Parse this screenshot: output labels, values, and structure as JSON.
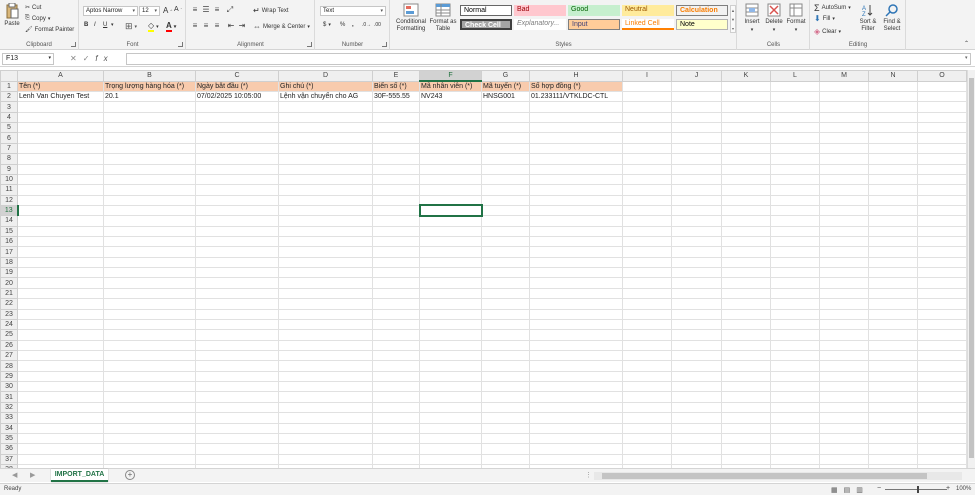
{
  "ribbon": {
    "clipboard": {
      "paste": "Paste",
      "cut": "Cut",
      "copy": "Copy",
      "format_painter": "Format Painter",
      "label": "Clipboard"
    },
    "font": {
      "name": "Aptos Narrow",
      "size": "12",
      "bold": "B",
      "italic": "I",
      "underline": "U",
      "label": "Font"
    },
    "alignment": {
      "wrap_text": "Wrap Text",
      "merge": "Merge & Center",
      "label": "Alignment"
    },
    "number": {
      "format": "Text",
      "currency": "$",
      "percent": "%",
      "comma": ",",
      "label": "Number"
    },
    "styles": {
      "conditional": "Conditional Formatting",
      "format_table": "Format as Table",
      "cells": [
        {
          "name": "Normal",
          "bg": "#ffffff",
          "fg": "#000000"
        },
        {
          "name": "Bad",
          "bg": "#ffc7ce",
          "fg": "#9c0006"
        },
        {
          "name": "Good",
          "bg": "#c6efce",
          "fg": "#006100"
        },
        {
          "name": "Neutral",
          "bg": "#ffeb9c",
          "fg": "#9c5700"
        },
        {
          "name": "Calculation",
          "bg": "#f2f2f2",
          "fg": "#fa7d00"
        },
        {
          "name": "Check Cell",
          "bg": "#a5a5a5",
          "fg": "#ffffff"
        },
        {
          "name": "Explanatory...",
          "bg": "#ffffff",
          "fg": "#7f7f7f"
        },
        {
          "name": "Input",
          "bg": "#ffcc99",
          "fg": "#3f3f76"
        },
        {
          "name": "Linked Cell",
          "bg": "#ffffff",
          "fg": "#fa7d00"
        },
        {
          "name": "Note",
          "bg": "#ffffcc",
          "fg": "#000000"
        }
      ],
      "label": "Styles"
    },
    "cells": {
      "insert": "Insert",
      "delete": "Delete",
      "format": "Format",
      "label": "Cells"
    },
    "editing": {
      "autosum": "AutoSum",
      "fill": "Fill",
      "clear": "Clear",
      "sort": "Sort & Filter",
      "find": "Find & Select",
      "label": "Editing"
    }
  },
  "formula_bar": {
    "name_box": "F13",
    "fx": "fx",
    "value": ""
  },
  "columns": [
    "A",
    "B",
    "C",
    "D",
    "E",
    "F",
    "G",
    "H",
    "I",
    "J",
    "K",
    "L",
    "M",
    "N",
    "O"
  ],
  "header_row": [
    "Tên (*)",
    "Trọng lượng hàng hóa (*)",
    "Ngày bắt đầu (*)",
    "Ghi chú (*)",
    "Biển số (*)",
    "Mã nhân viên (*)",
    "Mã tuyến (*)",
    "Số hợp đồng (*)"
  ],
  "data_row": [
    "Lenh Van Chuyen Test",
    "20.1",
    "07/02/2025 10:05:00",
    "Lệnh vận chuyển cho AG",
    "30F-555.55",
    "NV243",
    "HNSG001",
    "01.233111/VTKLDC-CTL"
  ],
  "row_count": 38,
  "active": {
    "col": "F",
    "row": 13
  },
  "sheet_tab": "IMPORT_DATA",
  "status": {
    "ready": "Ready",
    "zoom": "100%"
  }
}
